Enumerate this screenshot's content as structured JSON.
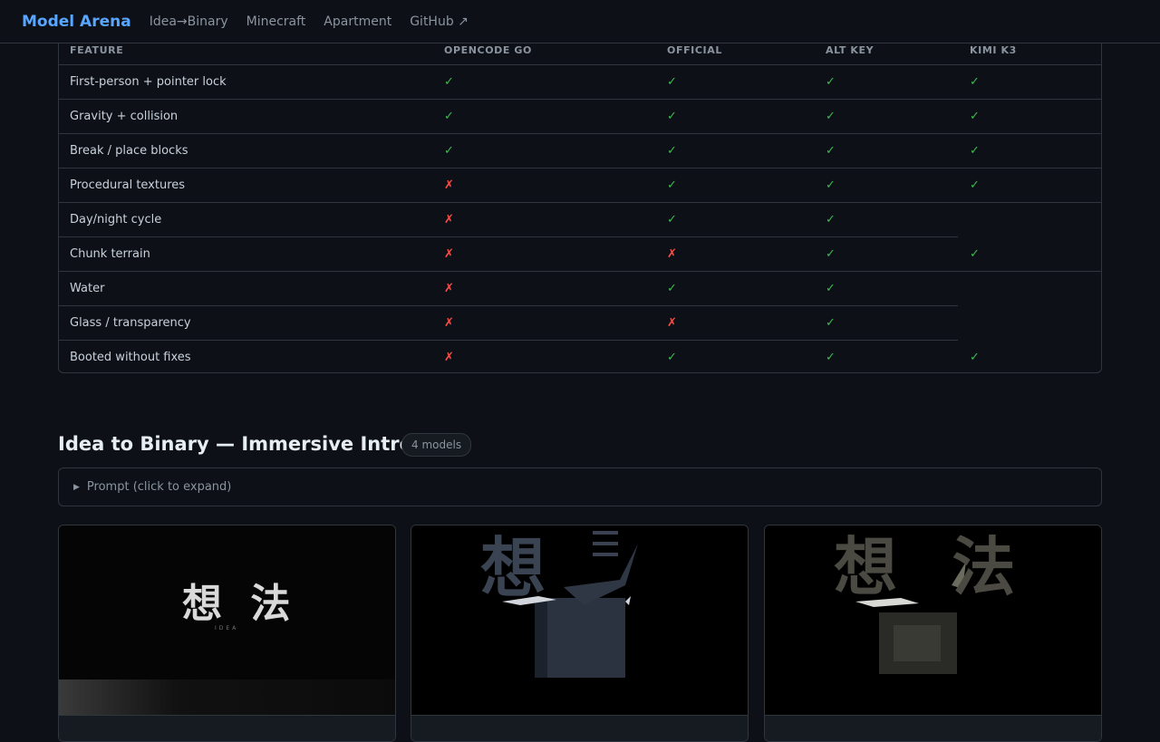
{
  "nav": {
    "brand": "Model Arena",
    "links": [
      "Idea→Binary",
      "Minecraft",
      "Apartment",
      "GitHub ↗"
    ]
  },
  "table": {
    "headers": [
      "FEATURE",
      "OPENCODE GO",
      "OFFICIAL",
      "ALT KEY",
      "KIMI K3"
    ],
    "rows": [
      {
        "feature": "First-person + pointer lock",
        "values": [
          "✓",
          "✓",
          "✓",
          "✓"
        ]
      },
      {
        "feature": "Gravity + collision",
        "values": [
          "✓",
          "✓",
          "✓",
          "✓"
        ]
      },
      {
        "feature": "Break / place blocks",
        "values": [
          "✓",
          "✓",
          "✓",
          "✓"
        ]
      },
      {
        "feature": "Procedural textures",
        "values": [
          "✗",
          "✓",
          "✓",
          "✓"
        ]
      },
      {
        "feature": "Day/night cycle",
        "values": [
          "✗",
          "✓",
          "✓",
          ""
        ]
      },
      {
        "feature": "Chunk terrain",
        "values": [
          "✗",
          "✗",
          "✓",
          "✓"
        ]
      },
      {
        "feature": "Water",
        "values": [
          "✗",
          "✓",
          "✓",
          ""
        ]
      },
      {
        "feature": "Glass / transparency",
        "values": [
          "✗",
          "✗",
          "✓",
          ""
        ]
      },
      {
        "feature": "Booted without fixes",
        "values": [
          "✗",
          "✓",
          "✓",
          "✓"
        ]
      }
    ]
  },
  "section": {
    "title": "Idea to Binary — Immersive Intro",
    "badge": "4 models",
    "prompt_label": "Prompt (click to expand)",
    "cards": [
      {
        "glyphs": "想 法",
        "caption": "IDEA"
      },
      {
        "glyphs": "想",
        "caption": ""
      },
      {
        "glyphs": "想 法",
        "caption": ""
      }
    ]
  },
  "colors": {
    "accent": "#58a6ff",
    "yes": "#3fb950",
    "no": "#f85149",
    "background": "#0d1117",
    "border": "#30363d"
  }
}
